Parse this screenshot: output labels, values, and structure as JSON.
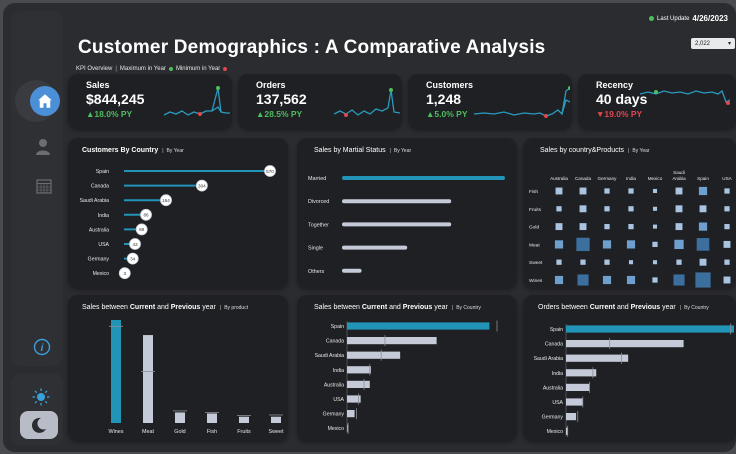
{
  "title": "Customer Demographics : A Comparative Analysis",
  "last_update": {
    "label": "Last Update",
    "date": "4/26/2023"
  },
  "year_filter": {
    "selected": "2,022"
  },
  "kpi_legend": {
    "overview": "KPI Overview",
    "max_label": "Maximum in Year",
    "min_label": "Minimum in Year"
  },
  "colors": {
    "accent": "#2194b8",
    "bar_light": "#c5cad8",
    "positive": "#4ebd5d",
    "negative": "#e2474d",
    "card": "#1f2024",
    "background": "#2b2c30"
  },
  "icons": [
    "home-icon",
    "user-icon",
    "calendar-icon",
    "info-icon",
    "sun-icon",
    "moon-icon"
  ],
  "kpis": [
    {
      "label": "Sales",
      "value": "$844,245",
      "change": "▲18.0% PY",
      "trend": "up"
    },
    {
      "label": "Orders",
      "value": "137,562",
      "change": "▲28.5% PY",
      "trend": "up"
    },
    {
      "label": "Customers",
      "value": "1,248",
      "change": "▲5.0% PY",
      "trend": "up"
    },
    {
      "label": "Recency",
      "value": "40 days",
      "change": "▼19.0% PY",
      "trend": "down"
    }
  ],
  "cards": {
    "by_country": {
      "title": "Customers By Country",
      "sub": "By Year"
    },
    "by_marital": {
      "title": "Sales by Martial Status",
      "sub": "By Year"
    },
    "by_country_products": {
      "title": "Sales by country&Products",
      "sub": "By Year"
    },
    "sales_product": {
      "title_pre": "Sales between ",
      "title_b1": "Current",
      "title_mid": " and ",
      "title_b2": "Previous",
      "title_post": " year",
      "sub": "By product"
    },
    "sales_country": {
      "title_pre": "Sales between ",
      "title_b1": "Current",
      "title_mid": " and ",
      "title_b2": "Previous",
      "title_post": " year",
      "sub": "By Country"
    },
    "orders_country": {
      "title_pre": "Orders between ",
      "title_b1": "Current",
      "title_mid": " and ",
      "title_b2": "Previous",
      "title_post": " year",
      "sub": "By Country"
    }
  },
  "chart_data": [
    {
      "id": "customers_by_country",
      "type": "bar",
      "categories": [
        "Spain",
        "Canada",
        "Saudi Arabia",
        "India",
        "Australia",
        "USA",
        "Germany",
        "Mexico"
      ],
      "values": [
        570,
        304,
        164,
        86,
        69,
        43,
        34,
        3
      ],
      "xlim": [
        0,
        570
      ]
    },
    {
      "id": "sales_by_marital",
      "type": "bar",
      "categories": [
        "Married",
        "Divorced",
        "Together",
        "Single",
        "Others"
      ],
      "values": [
        100,
        67,
        67,
        40,
        12
      ],
      "highlight": "Married"
    },
    {
      "id": "sales_country_products",
      "type": "heatmap",
      "columns": [
        "Australia",
        "Canada",
        "Germany",
        "India",
        "Mexico",
        "Saudi Arabia",
        "Spain",
        "USA"
      ],
      "rows": [
        "Fish",
        "Fruits",
        "Gold",
        "Meat",
        "Sweet",
        "Wines"
      ],
      "values": [
        [
          2,
          2,
          1,
          1,
          0.5,
          2,
          3,
          1
        ],
        [
          1,
          2,
          1,
          1,
          0.5,
          2,
          2,
          1
        ],
        [
          2,
          2,
          1,
          1,
          0.5,
          2,
          3,
          1
        ],
        [
          3,
          9,
          3,
          3,
          1,
          4,
          8,
          2
        ],
        [
          1,
          1,
          1,
          0.5,
          0.5,
          1,
          2,
          1
        ],
        [
          3,
          6,
          3,
          3,
          1,
          6,
          12,
          2
        ]
      ]
    },
    {
      "id": "sales_current_previous_product",
      "type": "bar",
      "categories": [
        "Wines",
        "Meat",
        "Gold",
        "Fish",
        "Fruits",
        "Sweet"
      ],
      "series": [
        {
          "name": "Current",
          "values": [
            410,
            350,
            42,
            38,
            25,
            25
          ]
        },
        {
          "name": "Previous",
          "values": [
            385,
            205,
            48,
            42,
            30,
            32
          ]
        }
      ]
    },
    {
      "id": "sales_current_previous_country",
      "type": "bar",
      "categories": [
        "Spain",
        "Canada",
        "Saudi Arabia",
        "India",
        "Australia",
        "USA",
        "Germany",
        "Mexico"
      ],
      "series": [
        {
          "name": "Current",
          "values": [
            375,
            236,
            140,
            63,
            60,
            36,
            20,
            2
          ]
        },
        {
          "name": "Previous",
          "values": [
            395,
            100,
            90,
            60,
            45,
            30,
            25,
            3
          ]
        }
      ]
    },
    {
      "id": "orders_current_previous_country",
      "type": "bar",
      "categories": [
        "Spain",
        "Canada",
        "Saudi Arabia",
        "India",
        "Australia",
        "USA",
        "Germany",
        "Mexico"
      ],
      "series": [
        {
          "name": "Current",
          "values": [
            100,
            70,
            37,
            18,
            14,
            10,
            6,
            1
          ]
        },
        {
          "name": "Previous",
          "values": [
            98,
            26,
            33,
            16,
            14,
            10,
            7,
            1
          ]
        }
      ]
    }
  ]
}
